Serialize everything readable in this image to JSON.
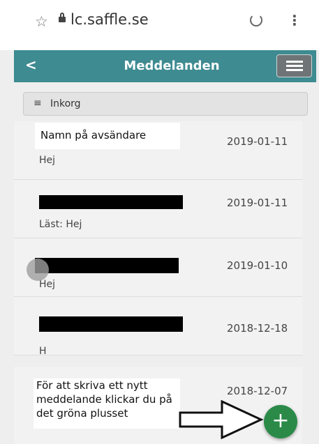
{
  "browser": {
    "url": "lc.saffle.se",
    "icons": {
      "bookmark": "star-icon",
      "lock": "lock-icon",
      "reload": "reload-icon",
      "menu": "kebab-icon"
    }
  },
  "appbar": {
    "back_label": "<",
    "title": "Meddelanden",
    "color": "#3e8b91"
  },
  "inbox": {
    "label": "Inkorg",
    "messages": [
      {
        "sender": "Namn på avsändare",
        "date": "2019-01-11",
        "preview": "Hej"
      },
      {
        "sender": "",
        "date": "2019-01-11",
        "preview": "Läst: Hej"
      },
      {
        "sender": "",
        "date": "2019-01-10",
        "preview": "Hej"
      },
      {
        "sender": "",
        "date": "2018-12-18",
        "preview": "H"
      },
      {
        "sender": "",
        "date": "2018-12-07",
        "preview": ""
      }
    ]
  },
  "annotation": {
    "text": "För att skriva ett nytt meddelande klickar du på det gröna plusset"
  },
  "fab": {
    "label": "+",
    "color": "#2b8a48"
  }
}
